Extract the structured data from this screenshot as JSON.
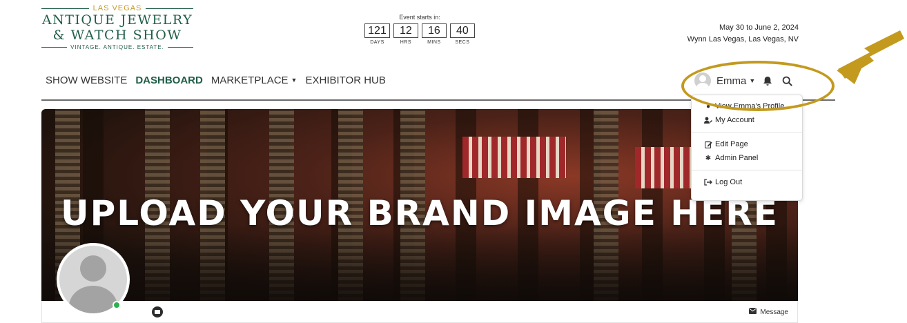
{
  "logo": {
    "top": "LAS VEGAS",
    "line1": "ANTIQUE JEWELRY",
    "line2": "& WATCH SHOW",
    "tagline": "VINTAGE. ANTIQUE. ESTATE."
  },
  "countdown": {
    "title": "Event starts in:",
    "units": [
      {
        "value": "121",
        "label": "DAYS"
      },
      {
        "value": "12",
        "label": "HRS"
      },
      {
        "value": "16",
        "label": "MINS"
      },
      {
        "value": "40",
        "label": "SECS"
      }
    ]
  },
  "event": {
    "dates": "May 30 to June 2, 2024",
    "location": "Wynn Las Vegas, Las Vegas, NV"
  },
  "nav": {
    "items": [
      {
        "label": "SHOW WEBSITE"
      },
      {
        "label": "DASHBOARD"
      },
      {
        "label": "MARKETPLACE"
      },
      {
        "label": "EXHIBITOR HUB"
      }
    ]
  },
  "user": {
    "name": "Emma"
  },
  "dropdown": {
    "items": [
      {
        "label": "View Emma's Profile",
        "icon": "person-icon"
      },
      {
        "label": "My Account",
        "icon": "user-edit-icon"
      },
      {
        "label": "Edit Page",
        "icon": "edit-icon"
      },
      {
        "label": "Admin Panel",
        "icon": "cog-icon"
      },
      {
        "label": "Log Out",
        "icon": "logout-icon"
      }
    ]
  },
  "banner": {
    "text": "UPLOAD YOUR BRAND IMAGE HERE"
  },
  "profile": {
    "message_label": "Message"
  },
  "colors": {
    "brand_green": "#1f5e46",
    "brand_gold": "#c49a2a",
    "highlight": "#c39a1e",
    "online": "#2bb24a"
  }
}
